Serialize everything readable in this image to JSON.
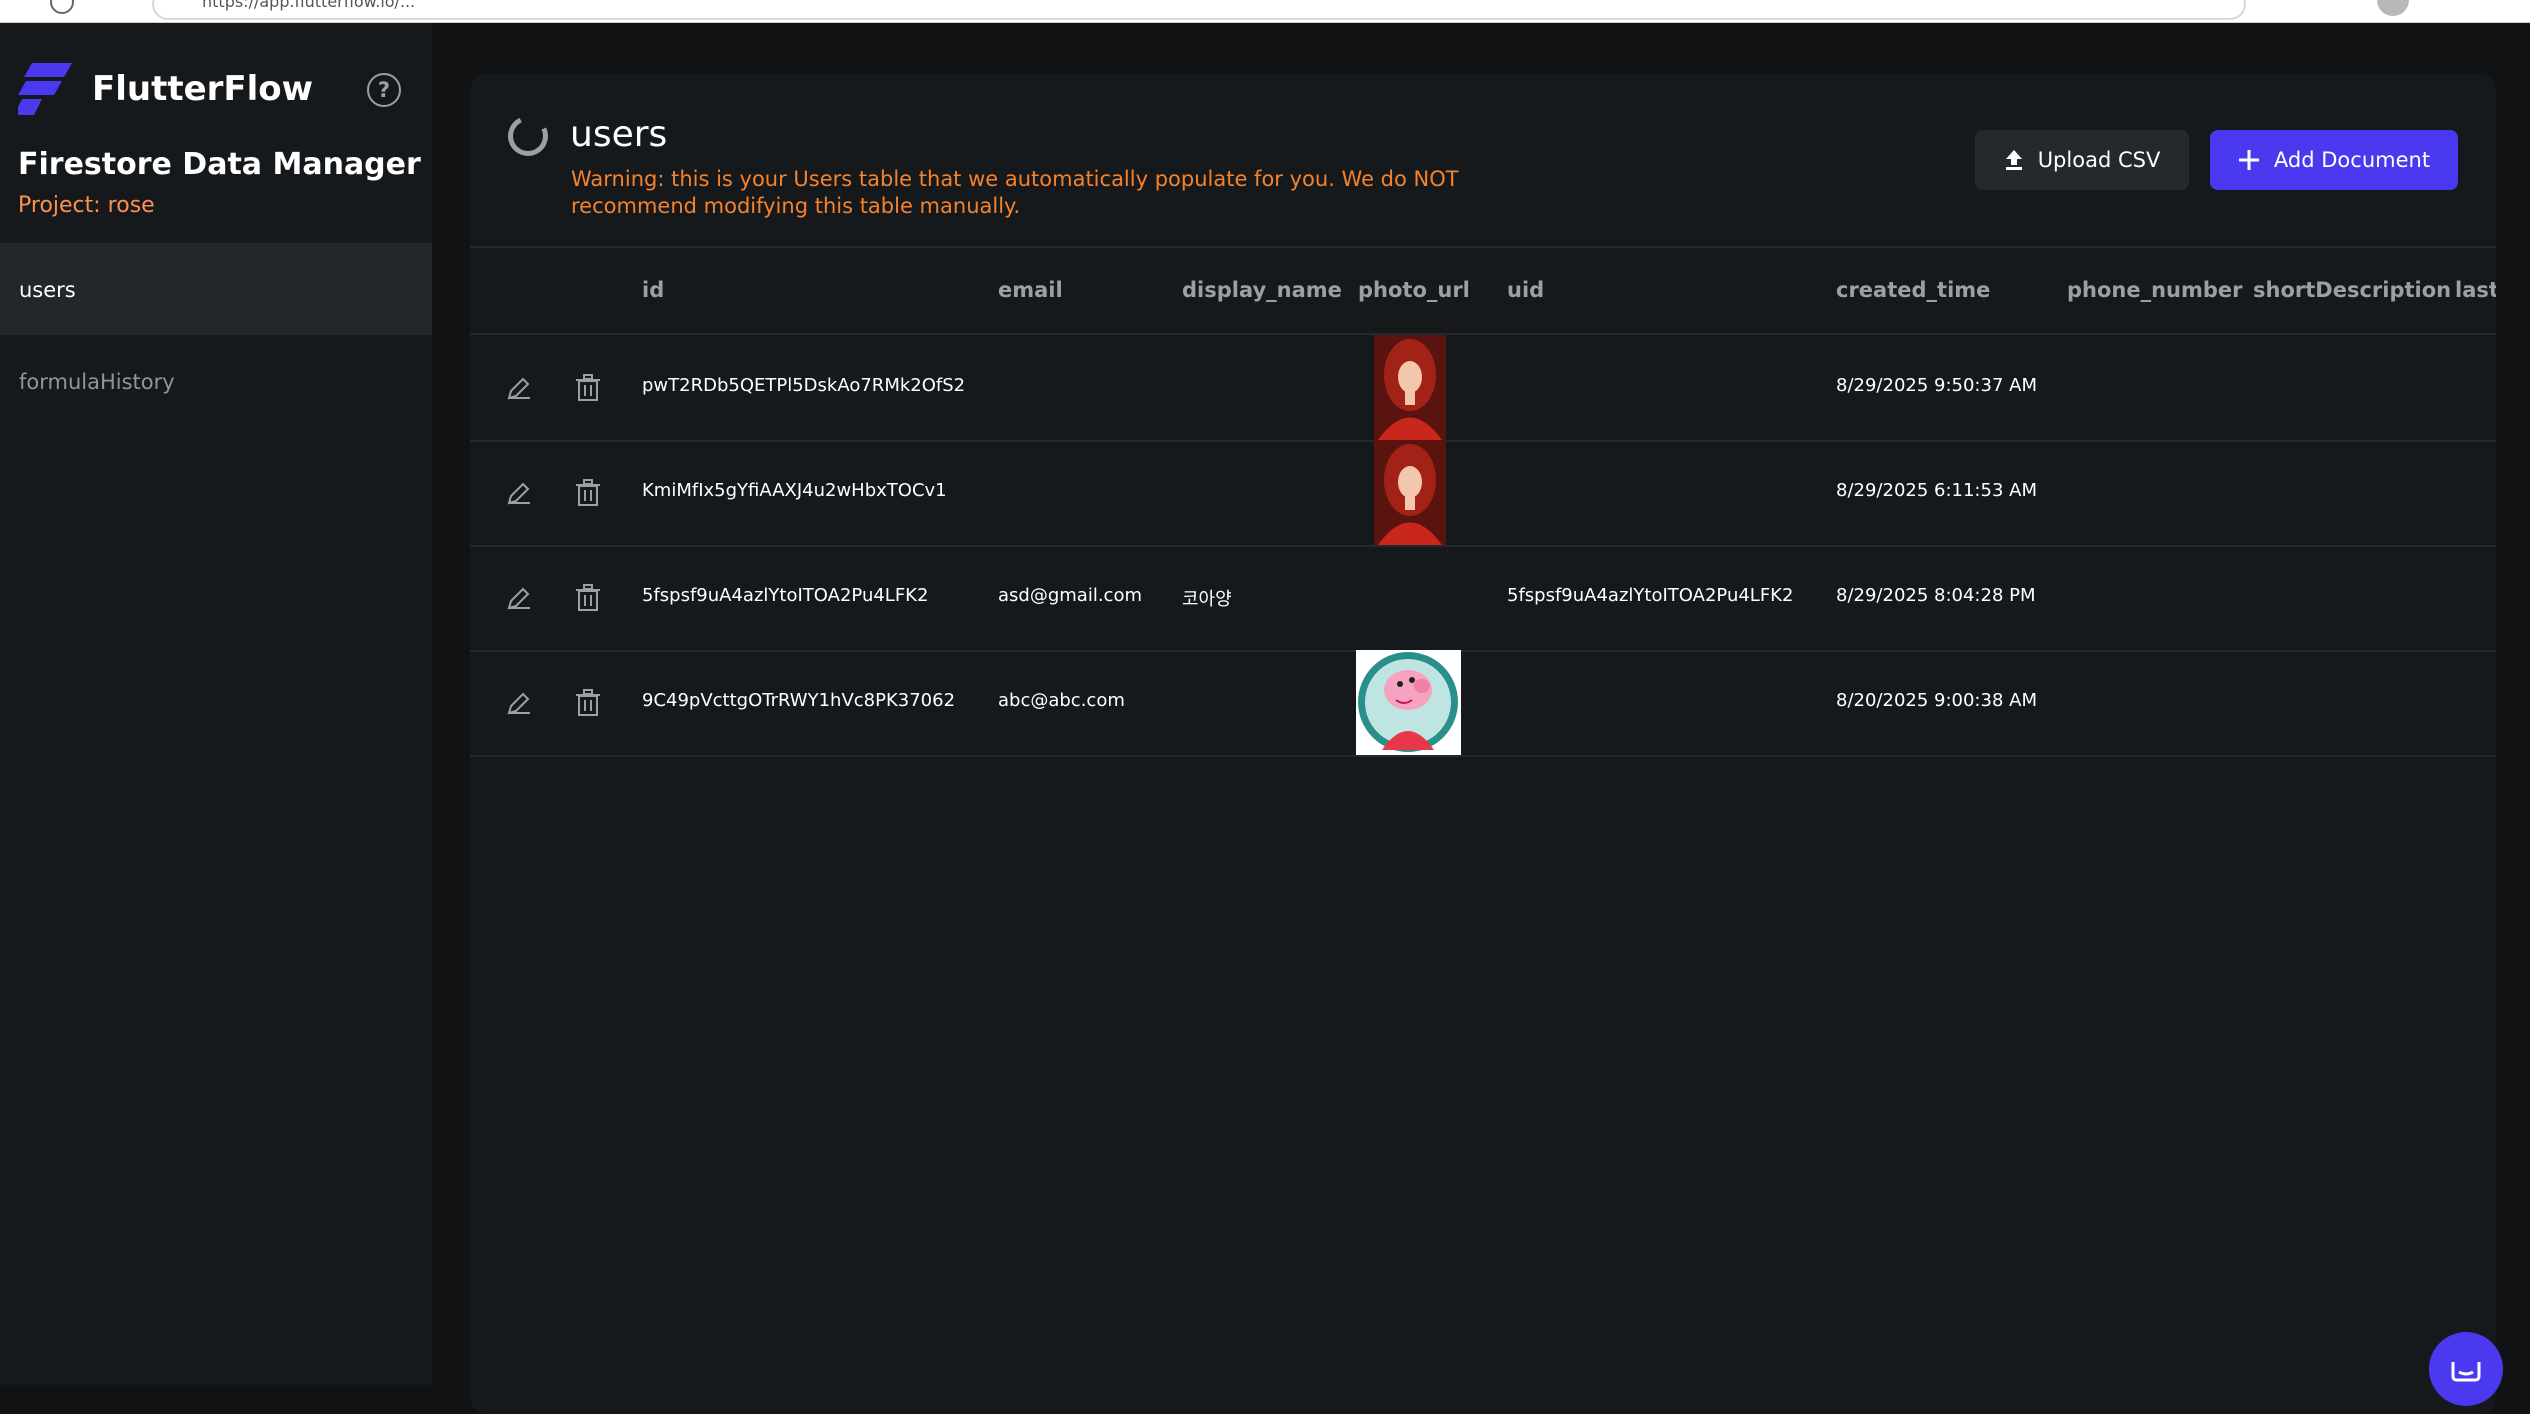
{
  "browser": {
    "url": "https://app.flutterflow.io/..."
  },
  "sidebar": {
    "brand": "FlutterFlow",
    "help_label": "?",
    "title": "Firestore Data Manager",
    "project": "Project: rose",
    "collections": [
      {
        "label": "users",
        "active": true
      },
      {
        "label": "formulaHistory",
        "active": false
      }
    ]
  },
  "main": {
    "collection_title": "users",
    "warning": "Warning: this is your Users table that we automatically populate for you. We do NOT recommend modifying this table manually.",
    "upload_label": "Upload CSV",
    "add_label": "Add Document",
    "accent_color": "#4b39ef",
    "warning_color": "#f5822a"
  },
  "table": {
    "columns": [
      "id",
      "email",
      "display_name",
      "photo_url",
      "uid",
      "created_time",
      "phone_number",
      "shortDescription",
      "last_"
    ],
    "rows": [
      {
        "id": "pwT2RDb5QETPl5DskAo7RMk2OfS2",
        "email": "",
        "display_name": "",
        "photo": "red-haired-woman",
        "uid": "",
        "created_time": "8/29/2025 9:50:37 AM"
      },
      {
        "id": "KmiMfIx5gYfiAAXJ4u2wHbxTOCv1",
        "email": "",
        "display_name": "",
        "photo": "red-haired-woman",
        "uid": "",
        "created_time": "8/29/2025 6:11:53 AM"
      },
      {
        "id": "5fspsf9uA4azlYtoITOA2Pu4LFK2",
        "email": "asd@gmail.com",
        "display_name": "코아양",
        "photo": "",
        "uid": "5fspsf9uA4azlYtoITOA2Pu4LFK2",
        "created_time": "8/29/2025 8:04:28 PM"
      },
      {
        "id": "9C49pVcttgOTrRWY1hVc8PK37062",
        "email": "abc@abc.com",
        "display_name": "",
        "photo": "pink-pig-cartoon",
        "uid": "",
        "created_time": "8/20/2025 9:00:38 AM"
      }
    ]
  }
}
